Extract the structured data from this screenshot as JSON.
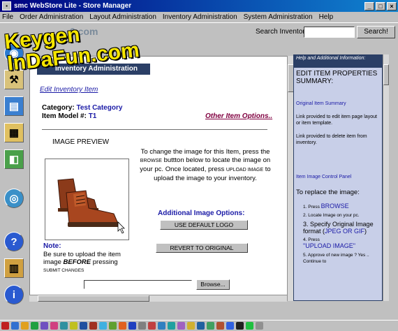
{
  "window": {
    "title": "smc WebStore Lite - Store Manager",
    "app_icon": "store-icon"
  },
  "menu": {
    "items": [
      {
        "label": "File"
      },
      {
        "label": "Order Administration"
      },
      {
        "label": "Layout Administration"
      },
      {
        "label": "Inventory Administration"
      },
      {
        "label": "System Administration"
      },
      {
        "label": "Help"
      }
    ]
  },
  "toolbar": {
    "brand_fragment": "2.com",
    "search_label": "Search Inventory:",
    "search_value": "",
    "search_button": "Search!"
  },
  "left_icons": [
    {
      "name": "globe-icon"
    },
    {
      "name": "tools-icon"
    },
    {
      "name": "inventory-icon"
    },
    {
      "name": "layout-icon"
    },
    {
      "name": "chart-icon"
    },
    {
      "name": "connect-icon"
    },
    {
      "name": "help-icon"
    },
    {
      "name": "calendar-icon"
    },
    {
      "name": "info-icon"
    }
  ],
  "main": {
    "header": "Inventory Administration",
    "edit_link": "Edit Inventory Item",
    "category_label": "Category:",
    "category_value": "Test Category",
    "model_label": "Item Model #:",
    "model_value": "T1",
    "other_options": "Other Item Options..",
    "preview_label": "IMAGE PREVIEW",
    "instructions_1": "To change the image for this Item, press the",
    "instructions_browse": "BROWSE",
    "instructions_2": "buttton below to locate the image on your pc. Once located, press",
    "instructions_upload": "UPLOAD IMAGE",
    "instructions_3": "to upload the image to your inventory.",
    "additional_options": "Additional Image Options:",
    "use_default_logo": "USE DEFAULT LOGO",
    "revert": "REVERT TO ORIGINAL",
    "note_label": "Note:",
    "note_1": "Be sure to upload the item image",
    "note_before": "BEFORE",
    "note_2": "pressing",
    "note_submit": "SUBMIT CHANGES",
    "browse_value": "",
    "browse_button": "Browse..."
  },
  "help": {
    "head": "Help and Additional Information:",
    "title": "EDIT ITEM PROPERTIES SUMMARY:",
    "summary_link": "Original Item Summary",
    "summary_1": "Link provided to edit item page layout or item template.",
    "summary_2": "Link provided to delete item from inventory.",
    "control_panel": "Item Image Control Panel",
    "replace": "To replace the image:",
    "steps": [
      {
        "n": "1.",
        "text": "Press",
        "em": "BROWSE"
      },
      {
        "n": "2.",
        "text": "Locate Image on your pc.",
        "em": ""
      },
      {
        "n": "3.",
        "text": "Specify Original Image format (",
        "em": "JPEG OR GIF"
      },
      {
        "n": "4.",
        "text": "Press",
        "em": "\"UPLOAD IMAGE\""
      },
      {
        "n": "5.",
        "text": "Approve of new image ? Yes .. Continue to",
        "em": ""
      }
    ]
  },
  "watermark": {
    "line1": "Keygen",
    "line2": "InDaFun.com"
  },
  "colors": {
    "titlebar": "#000080",
    "panel_header": "#2b3f66",
    "link_blue": "#1a1aa6",
    "help_bg": "#c8cfe8"
  }
}
